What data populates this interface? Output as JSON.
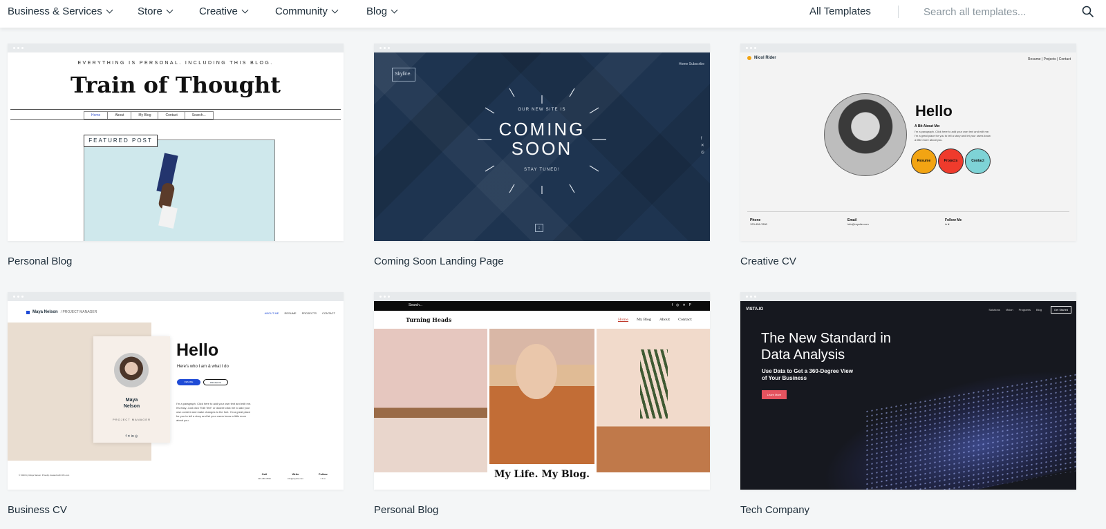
{
  "nav": {
    "items": [
      {
        "label": "Business & Services"
      },
      {
        "label": "Store"
      },
      {
        "label": "Creative"
      },
      {
        "label": "Community"
      },
      {
        "label": "Blog"
      }
    ],
    "all_templates": "All Templates",
    "search_placeholder": "Search all templates..."
  },
  "templates": [
    {
      "caption": "Personal Blog",
      "preview": {
        "tagline": "EVERYTHING IS PERSONAL. INCLUDING THIS BLOG.",
        "title": "Train of Thought",
        "menu": [
          "Home",
          "About",
          "My Blog",
          "Contact",
          "Search..."
        ],
        "featured": "FEATURED POST"
      }
    },
    {
      "caption": "Coming Soon Landing Page",
      "preview": {
        "logo": "Skyline.",
        "links": "Home   Subscribe",
        "kicker": "OUR NEW SITE IS",
        "headline_1": "COMING",
        "headline_2": "SOON",
        "footer": "STAY TUNED!"
      }
    },
    {
      "caption": "Creative CV",
      "preview": {
        "name": "Nicol Rider",
        "nav": "Resume | Projects | Contact",
        "hello": "Hello",
        "about_title": "A Bit About Me:",
        "about_text": "I'm a paragraph. Click here to add your own text and edit me. I'm a great place for you to tell a story and let your users know a little more about you.",
        "buttons": [
          "Resume",
          "Projects",
          "Contact"
        ],
        "footer": [
          {
            "title": "Phone",
            "value": "123-456-7890"
          },
          {
            "title": "Email",
            "value": "info@mysite.com"
          },
          {
            "title": "Follow Me",
            "value": "in ♥"
          }
        ]
      }
    },
    {
      "caption": "Business CV",
      "preview": {
        "brand_name": "Maya Nelson",
        "brand_role": "/ PROJECT MANAGER",
        "nav": [
          "ABOUT ME",
          "RESUME",
          "PROJECTS",
          "CONTACT"
        ],
        "card_name_1": "Maya",
        "card_name_2": "Nelson",
        "card_role": "PROJECT MANAGER",
        "hello": "Hello",
        "sub": "Here's who I am & what I do",
        "btn_resume": "RESUME",
        "btn_projects": "PROJECTS",
        "para": "I'm a paragraph. Click here to add your own text and edit me. It's easy. Just click \"Edit Text\" or double click me to add your own content and make changes to the font. I'm a great place for you to tell a story and let your users know a little more about you.",
        "copyright": "© 2023 by Maya Nelson. Proudly created with Wix.com",
        "footer": [
          {
            "title": "Call",
            "value": "123-456-7890"
          },
          {
            "title": "Write",
            "value": "info@mysite.com"
          },
          {
            "title": "Follow",
            "value": "f ✕ in"
          }
        ]
      }
    },
    {
      "caption": "Personal Blog",
      "preview": {
        "search": "Search...",
        "logo": "Turning Heads",
        "nav": [
          "Home",
          "My Blog",
          "About",
          "Contact"
        ],
        "tagline": "My Life. My Blog."
      }
    },
    {
      "caption": "Tech Company",
      "preview": {
        "logo": "VISTA.IO",
        "nav": [
          "Solutions",
          "Vision",
          "Programs",
          "Blog"
        ],
        "cta": "Get Started",
        "headline": "The New Standard in Data Analysis",
        "subhead": "Use Data to Get a 360-Degree View of Your Business",
        "button": "Learn More"
      }
    }
  ]
}
